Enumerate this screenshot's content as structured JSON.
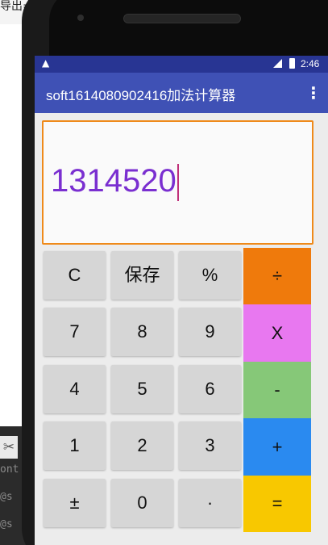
{
  "background": {
    "title_fragment": "导出=",
    "scissors_glyph": "✂",
    "partial_lines": [
      "ont",
      "@s",
      "@s"
    ]
  },
  "status_bar": {
    "alert_glyph": "▲",
    "time": "2:46"
  },
  "app_bar": {
    "title": "soft1614080902416加法计算器",
    "menu_glyph": "⋮"
  },
  "display": {
    "value": "1314520",
    "border_color": "#ef8a1a",
    "text_color": "#7a2fd0"
  },
  "keypad": {
    "rows": [
      [
        "C",
        "保存",
        "%",
        "÷"
      ],
      [
        "7",
        "8",
        "9",
        "X"
      ],
      [
        "4",
        "5",
        "6",
        "-"
      ],
      [
        "1",
        "2",
        "3",
        "+"
      ],
      [
        "±",
        "0",
        "·",
        "="
      ]
    ],
    "operator_colors": [
      "#ef7a0c",
      "#e878f0",
      "#86c878",
      "#2a8af0",
      "#f8c800"
    ],
    "grey_key_color": "#d6d6d6"
  },
  "colors": {
    "status_bar": "#283593",
    "app_bar": "#3f51b5",
    "screen_background": "#ececec"
  }
}
